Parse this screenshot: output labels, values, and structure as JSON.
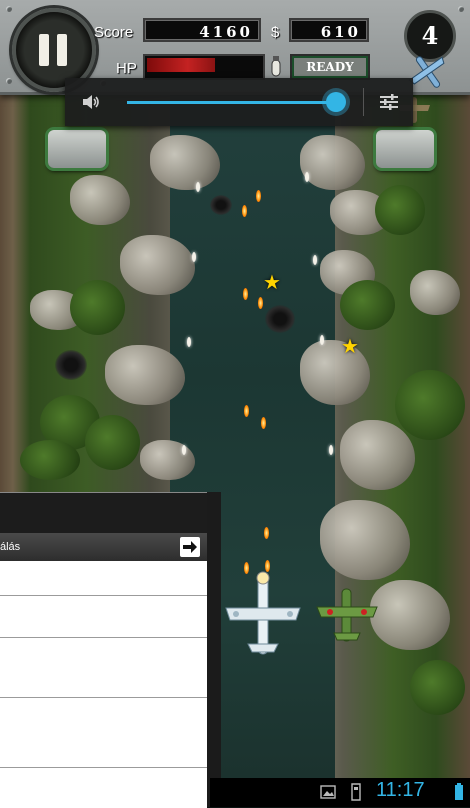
{
  "hud": {
    "score_label": "Score",
    "score_value": "4160",
    "money_symbol": "$",
    "money_value": "610",
    "hp_label": "HP",
    "hp_level": 0.62,
    "special_status": "READY",
    "level": "4",
    "pause_icon": "pause-icon"
  },
  "volume": {
    "icon": "speaker-icon",
    "level": 0.98,
    "settings_icon": "equalizer-sliders-icon",
    "accent": "#33b5e5"
  },
  "settings_sheet": {
    "title": "álás",
    "action_icon": "arrow-right-icon"
  },
  "statusbar": {
    "time": "11:17",
    "icons": [
      "gallery-icon",
      "sd-card-icon",
      "battery-icon"
    ]
  },
  "colors": {
    "hp_red": "#c42222",
    "ready_green": "#1b4e2a",
    "android_blue": "#33b5e5"
  }
}
